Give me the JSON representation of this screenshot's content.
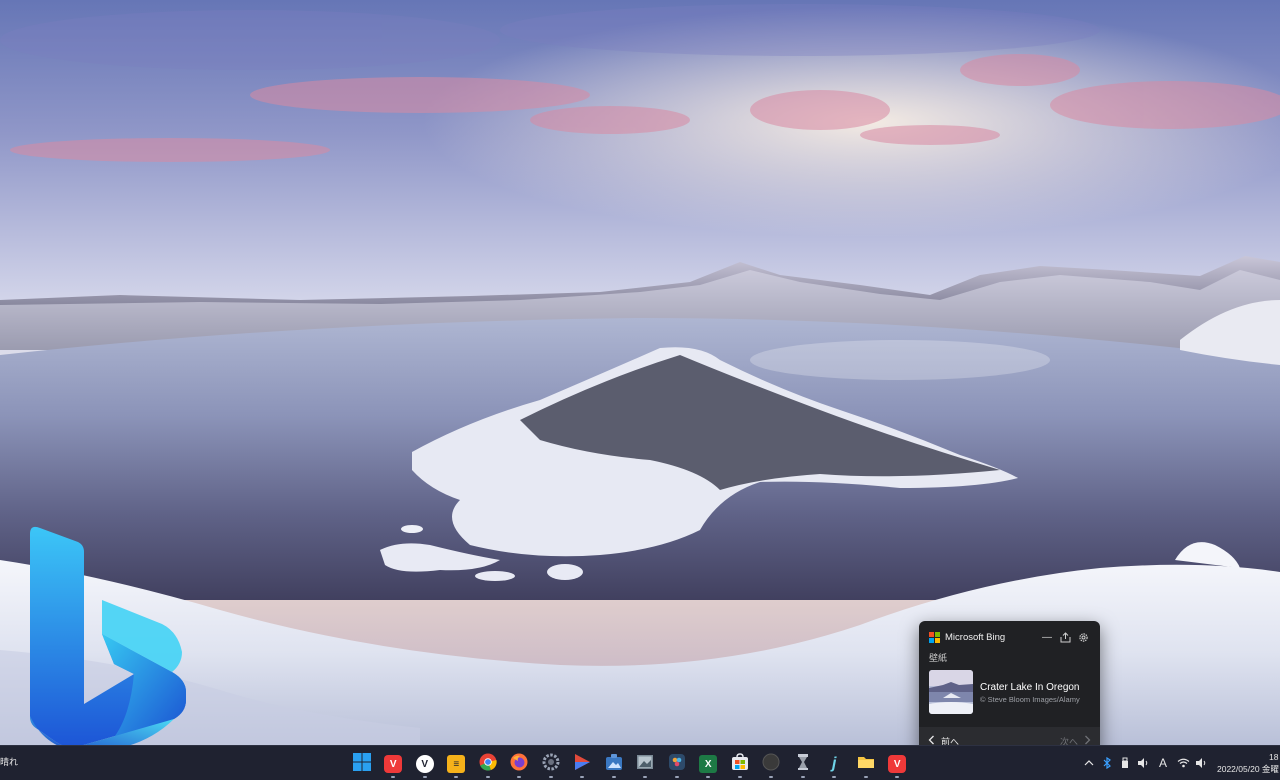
{
  "popup": {
    "title": "Microsoft Bing",
    "section": "壁紙",
    "image_name": "Crater Lake In Oregon",
    "credit": "© Steve Bloom Images/Alamy",
    "prev_label": "前へ",
    "next_label": "次へ"
  },
  "taskbar": {
    "weather": "晴れ",
    "clock_time": "18",
    "clock_date": "2022/05/20 金曜",
    "input_indicator": "A"
  },
  "icons": {
    "popup_minimize": "minimize-icon",
    "popup_share": "share-icon",
    "popup_settings": "gear-icon",
    "prev": "chevron-left-icon",
    "next": "chevron-right-icon"
  },
  "apps": [
    {
      "name": "start",
      "glyph": "",
      "color": "#2aa0f0"
    },
    {
      "name": "vivaldi",
      "glyph": "V",
      "color": "#ef3939"
    },
    {
      "name": "vivaldi-alt",
      "glyph": "V",
      "color": "#ffffff"
    },
    {
      "name": "notes",
      "glyph": "≡",
      "color": "#f6b21a"
    },
    {
      "name": "chrome",
      "glyph": "",
      "color": "#e94235"
    },
    {
      "name": "firefox",
      "glyph": "",
      "color": "#ff7139"
    },
    {
      "name": "settings",
      "glyph": "⚙",
      "color": "#6b7180"
    },
    {
      "name": "media",
      "glyph": "▶",
      "color": "#e24a3b"
    },
    {
      "name": "photo",
      "glyph": "",
      "color": "#3a78c2"
    },
    {
      "name": "gallery",
      "glyph": "",
      "color": "#7b8a96"
    },
    {
      "name": "resolve",
      "glyph": "",
      "color": "#2d4a6a"
    },
    {
      "name": "excel",
      "glyph": "X",
      "color": "#1d7a45"
    },
    {
      "name": "store",
      "glyph": "",
      "color": "#1a8fe0"
    },
    {
      "name": "circle",
      "glyph": "",
      "color": "#3a3a3a"
    },
    {
      "name": "terminal",
      "glyph": "",
      "color": "#9aa0aa"
    },
    {
      "name": "j-app",
      "glyph": "j",
      "color": "#1f2230"
    },
    {
      "name": "explorer",
      "glyph": "",
      "color": "#f5c542"
    },
    {
      "name": "vivaldi-2",
      "glyph": "V",
      "color": "#ef3939"
    }
  ],
  "colors": {
    "popup_bg": "#202124",
    "taskbar_bg": "#1f2230",
    "bing_gradient_start": "#38c1f5",
    "bing_gradient_end": "#1d4fd8"
  }
}
